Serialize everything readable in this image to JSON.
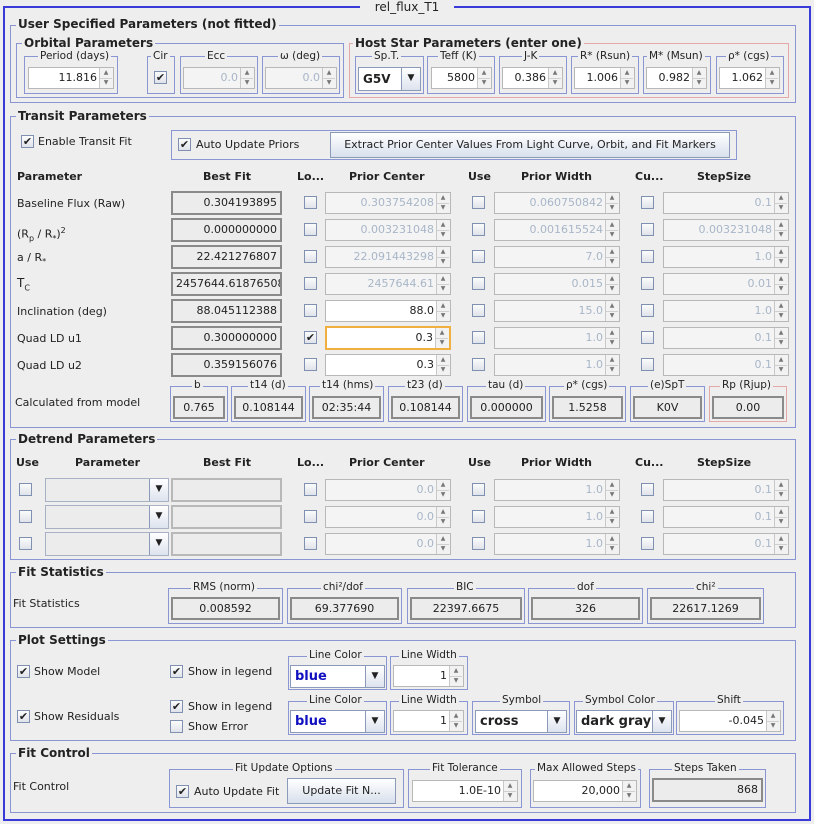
{
  "window": {
    "title": "rel_flux_T1"
  },
  "user_params": {
    "legend": "User Specified Parameters (not fitted)",
    "orbital": {
      "legend": "Orbital Parameters",
      "period_label": "Period (days)",
      "period_value": "11.816",
      "cir_label": "Cir",
      "cir_checked": "✔",
      "ecc_label": "Ecc",
      "ecc_value": "0.0",
      "omega_label": "ω (deg)",
      "omega_value": "0.0"
    },
    "host": {
      "legend": "Host Star Parameters (enter one)",
      "spt_label": "Sp.T.",
      "spt_value": "G5V",
      "teff_label": "Teff (K)",
      "teff_value": "5800",
      "jk_label": "J-K",
      "jk_value": "0.386",
      "rstar_label": "R* (Rsun)",
      "rstar_value": "1.006",
      "mstar_label": "M* (Msun)",
      "mstar_value": "0.982",
      "rho_label": "ρ* (cgs)",
      "rho_value": "1.062"
    }
  },
  "transit": {
    "legend": "Transit Parameters",
    "enable_label": "Enable Transit Fit",
    "enable_checked": "✔",
    "auto_priors_label": "Auto Update Priors",
    "auto_priors_checked": "✔",
    "extract_button": "Extract Prior Center Values From Light Curve, Orbit, and Fit Markers",
    "headers": {
      "parameter": "Parameter",
      "best_fit": "Best Fit",
      "lock": "Lo...",
      "prior_center": "Prior Center",
      "use": "Use",
      "prior_width": "Prior Width",
      "custom": "Cu...",
      "step": "StepSize"
    },
    "rows": [
      {
        "label": "Baseline Flux (Raw)",
        "best": "0.304193895",
        "lock": "",
        "center": "0.303754208",
        "use": "",
        "width": "0.060750842",
        "cu": "",
        "step": "0.1"
      },
      {
        "label": "",
        "best": "0.000000000",
        "lock": "",
        "center": "0.003231048",
        "use": "",
        "width": "0.001615524",
        "cu": "",
        "step": "0.003231048"
      },
      {
        "label": "a / R",
        "best": "22.421276807",
        "lock": "",
        "center": "22.091443298",
        "use": "",
        "width": "7.0",
        "cu": "",
        "step": "1.0"
      },
      {
        "label": "T",
        "best": "2457644.61876508",
        "lock": "",
        "center": "2457644.61",
        "use": "",
        "width": "0.015",
        "cu": "",
        "step": "0.01"
      },
      {
        "label": "Inclination (deg)",
        "best": "88.045112388",
        "lock": "",
        "center": "88.0",
        "use": "",
        "width": "15.0",
        "cu": "",
        "step": "1.0"
      },
      {
        "label": "Quad LD u1",
        "best": "0.300000000",
        "lock": "✔",
        "center": "0.3",
        "use": "",
        "width": "1.0",
        "cu": "",
        "step": "0.1"
      },
      {
        "label": "Quad LD u2",
        "best": "0.359156076",
        "lock": "",
        "center": "0.3",
        "use": "",
        "width": "1.0",
        "cu": "",
        "step": "0.1"
      }
    ],
    "rp_label": {
      "r": "(R",
      "p": "p",
      "mid": " / R",
      "star": "*",
      "close": ")",
      "sq": "2"
    },
    "a_star": "*",
    "tc_sub": "C",
    "calc_label": "Calculated from model",
    "calc": [
      {
        "label": "b",
        "value": "0.765"
      },
      {
        "label": "t14 (d)",
        "value": "0.108144"
      },
      {
        "label": "t14 (hms)",
        "value": "02:35:44"
      },
      {
        "label": "t23 (d)",
        "value": "0.108144"
      },
      {
        "label": "tau (d)",
        "value": "0.000000"
      },
      {
        "label": "ρ* (cgs)",
        "value": "1.5258"
      },
      {
        "label": "(e)SpT",
        "value": "K0V"
      },
      {
        "label": "Rp (Rjup)",
        "value": "0.00"
      }
    ]
  },
  "detrend": {
    "legend": "Detrend Parameters",
    "headers": {
      "use": "Use",
      "parameter": "Parameter",
      "best_fit": "Best Fit",
      "lock": "Lo...",
      "prior_center": "Prior Center",
      "use2": "Use",
      "prior_width": "Prior Width",
      "custom": "Cu...",
      "step": "StepSize"
    },
    "rows": [
      {
        "center": "0.0",
        "width": "1.0",
        "step": "0.1"
      },
      {
        "center": "0.0",
        "width": "1.0",
        "step": "0.1"
      },
      {
        "center": "0.0",
        "width": "1.0",
        "step": "0.1"
      }
    ]
  },
  "fit_stats": {
    "legend": "Fit Statistics",
    "row_label": "Fit Statistics",
    "items": [
      {
        "label": "RMS (norm)",
        "value": "0.008592"
      },
      {
        "label": "chi²/dof",
        "value": "69.377690"
      },
      {
        "label": "BIC",
        "value": "22397.6675"
      },
      {
        "label": "dof",
        "value": "326"
      },
      {
        "label": "chi²",
        "value": "22617.1269"
      }
    ]
  },
  "plot": {
    "legend": "Plot Settings",
    "show_model": "Show Model",
    "show_model_checked": "✔",
    "model_legend": "Show in legend",
    "model_legend_checked": "✔",
    "line_color_label": "Line Color",
    "model_color": "blue",
    "line_width_label": "Line Width",
    "model_width": "1",
    "show_residuals": "Show Residuals",
    "show_residuals_checked": "✔",
    "res_legend": "Show in legend",
    "res_legend_checked": "✔",
    "show_error": "Show Error",
    "show_error_checked": "",
    "res_color": "blue",
    "res_width": "1",
    "symbol_label": "Symbol",
    "symbol_value": "cross",
    "symbol_color_label": "Symbol Color",
    "symbol_color_value": "dark gray",
    "shift_label": "Shift",
    "shift_value": "-0.045",
    "colors": {
      "accent_blue": "#1010c0",
      "border_blue": "#3a3ad8"
    }
  },
  "fit_control": {
    "legend": "Fit Control",
    "row_label": "Fit Control",
    "options_label": "Fit Update Options",
    "auto_update": "Auto Update Fit",
    "auto_update_checked": "✔",
    "update_button": "Update Fit N...",
    "tolerance_label": "Fit Tolerance",
    "tolerance_value": "1.0E-10",
    "max_steps_label": "Max Allowed Steps",
    "max_steps_value": "20,000",
    "steps_taken_label": "Steps Taken",
    "steps_taken_value": "868"
  }
}
